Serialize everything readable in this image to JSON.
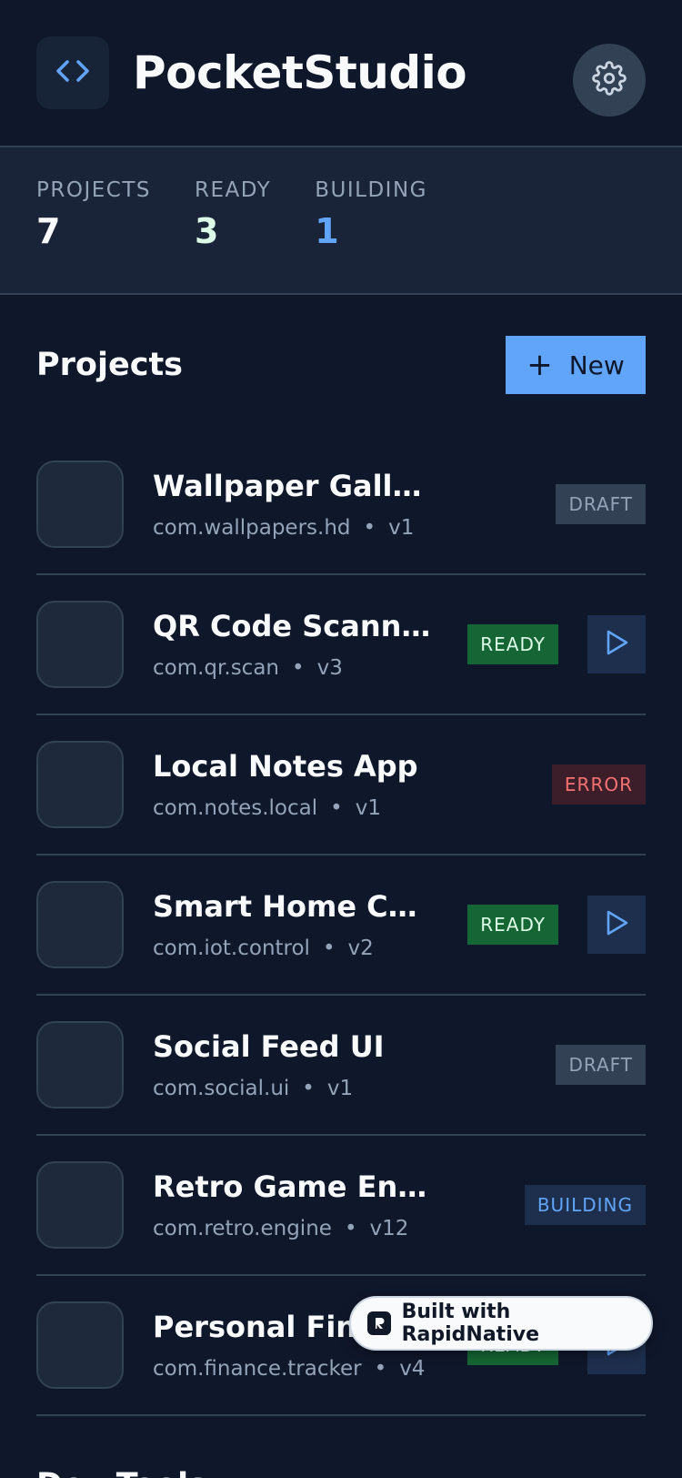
{
  "header": {
    "title": "PocketStudio",
    "logo_icon": "code-icon",
    "settings_icon": "gear-icon"
  },
  "stats": [
    {
      "label": "PROJECTS",
      "value": "7",
      "color": "#f8fafc"
    },
    {
      "label": "READY",
      "value": "3",
      "color": "#dcfce7"
    },
    {
      "label": "BUILDING",
      "value": "1",
      "color": "#60a5fa"
    }
  ],
  "projects_section": {
    "title": "Projects",
    "new_button_label": "New"
  },
  "projects": [
    {
      "name": "Wallpaper Gallery",
      "package": "com.wallpapers.hd",
      "version": "v1",
      "status": "DRAFT",
      "playable": false
    },
    {
      "name": "QR Code Scanner",
      "package": "com.qr.scan",
      "version": "v3",
      "status": "READY",
      "playable": true
    },
    {
      "name": "Local Notes App",
      "package": "com.notes.local",
      "version": "v1",
      "status": "ERROR",
      "playable": false
    },
    {
      "name": "Smart Home Cont...",
      "package": "com.iot.control",
      "version": "v2",
      "status": "READY",
      "playable": true
    },
    {
      "name": "Social Feed UI",
      "package": "com.social.ui",
      "version": "v1",
      "status": "DRAFT",
      "playable": false
    },
    {
      "name": "Retro Game Engine",
      "package": "com.retro.engine",
      "version": "v12",
      "status": "BUILDING",
      "playable": false
    },
    {
      "name": "Personal Fina",
      "package": "com.finance.tracker",
      "version": "v4",
      "status": "READY",
      "playable": true
    }
  ],
  "separator": "•",
  "devtools": {
    "title": "Dev Tools"
  },
  "pill": {
    "label": "Built with RapidNative"
  },
  "colors": {
    "background": "#0f172a",
    "accent": "#60a5fa",
    "ready": "#166534",
    "error": "#f87171"
  }
}
